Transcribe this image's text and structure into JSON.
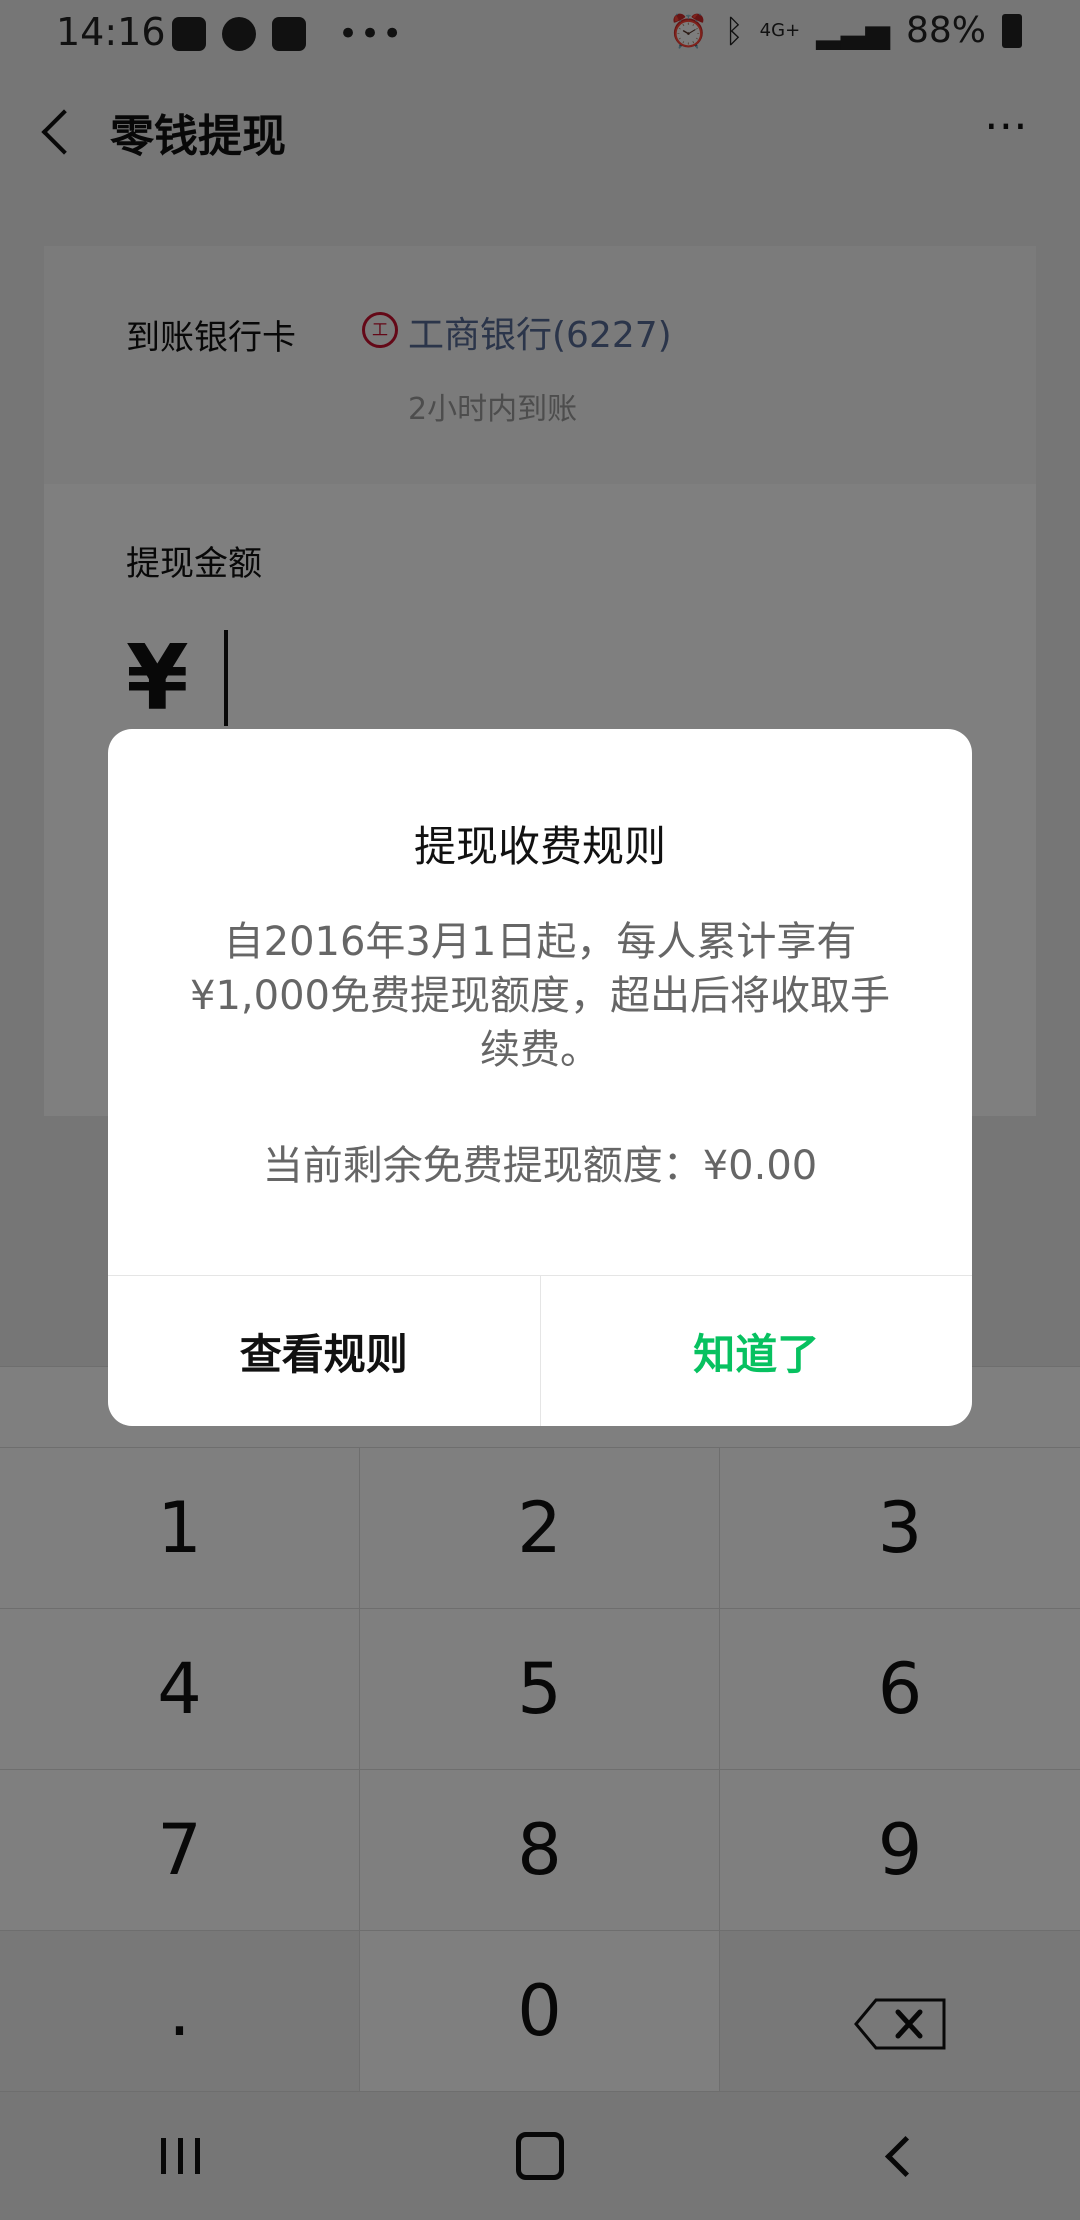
{
  "status_bar": {
    "time": "14:16",
    "network": "4G+",
    "battery": "88%"
  },
  "app_bar": {
    "title": "零钱提现",
    "back_icon": "back-chevron-icon",
    "more_icon": "more-dots-icon",
    "more_glyph": "⋯"
  },
  "withdraw": {
    "bank_label": "到账银行卡",
    "bank_icon": "icbc-logo-icon",
    "bank_name": "工商银行(6227)",
    "arrival_time": "2小时内到账",
    "amount_label": "提现金额",
    "currency_symbol": "¥",
    "amount_value": ""
  },
  "keypad": {
    "keys": [
      "1",
      "2",
      "3",
      "4",
      "5",
      "6",
      "7",
      "8",
      "9",
      ".",
      "0"
    ],
    "delete_icon": "backspace-icon"
  },
  "dialog": {
    "title": "提现收费规则",
    "body": "自2016年3月1日起，每人累计享有¥1,000免费提现额度，超出后将收取手续费。",
    "quota": "当前剩余免费提现额度：¥0.00",
    "view_rules_label": "查看规则",
    "ok_label": "知道了",
    "ok_color": "#07c160"
  },
  "nav_bar": {
    "recent_icon": "recent-apps-icon",
    "home_icon": "home-icon",
    "back_icon": "back-icon"
  }
}
